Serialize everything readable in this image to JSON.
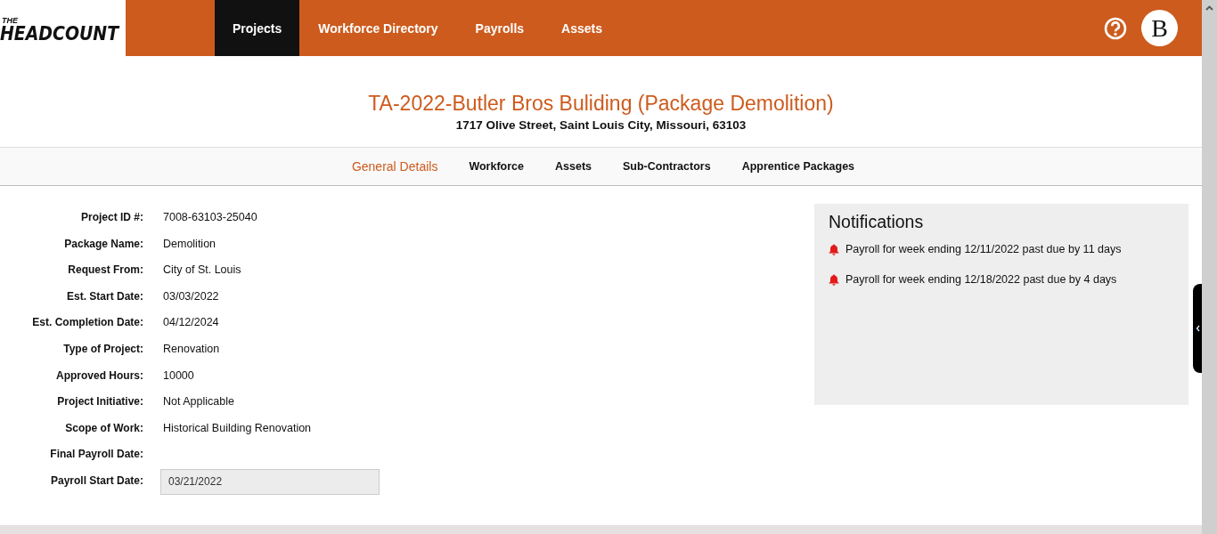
{
  "header": {
    "logo_small": "THE",
    "logo": "HEADCOUNT",
    "nav": [
      {
        "label": "Projects",
        "selected": true
      },
      {
        "label": "Workforce Directory",
        "selected": false
      },
      {
        "label": "Payrolls",
        "selected": false
      },
      {
        "label": "Assets",
        "selected": false
      }
    ],
    "avatar": "B"
  },
  "project": {
    "title": "TA-2022-Butler Bros Buliding (Package Demolition)",
    "address": "1717 Olive Street, Saint Louis City, Missouri, 63103"
  },
  "tabs": [
    {
      "label": "General Details",
      "selected": true
    },
    {
      "label": "Workforce",
      "selected": false
    },
    {
      "label": "Assets",
      "selected": false
    },
    {
      "label": "Sub-Contractors",
      "selected": false
    },
    {
      "label": "Apprentice Packages",
      "selected": false
    }
  ],
  "details": [
    {
      "kind": "text",
      "label": "Project ID #:",
      "value": "7008-63103-25040"
    },
    {
      "kind": "text",
      "label": "Package Name:",
      "value": "Demolition"
    },
    {
      "kind": "text",
      "label": "Request From:",
      "value": "City of St. Louis"
    },
    {
      "kind": "text",
      "label": "Est. Start Date:",
      "value": "03/03/2022"
    },
    {
      "kind": "text",
      "label": "Est. Completion Date:",
      "value": "04/12/2024"
    },
    {
      "kind": "text",
      "label": "Type of Project:",
      "value": "Renovation"
    },
    {
      "kind": "text",
      "label": "Approved Hours:",
      "value": "10000"
    },
    {
      "kind": "text",
      "label": "Project Initiative:",
      "value": "Not Applicable"
    },
    {
      "kind": "text",
      "label": "Scope of Work:",
      "value": "Historical Building Renovation"
    },
    {
      "kind": "text",
      "label": "Final Payroll Date:"
    },
    {
      "kind": "input",
      "label": "Payroll Start Date:",
      "value": "03/21/2022"
    }
  ],
  "notifications": {
    "title": "Notifications",
    "items": [
      "Payroll for week ending 12/11/2022 past due by 11 days",
      "Payroll for week ending 12/18/2022 past due by 4 days"
    ]
  }
}
